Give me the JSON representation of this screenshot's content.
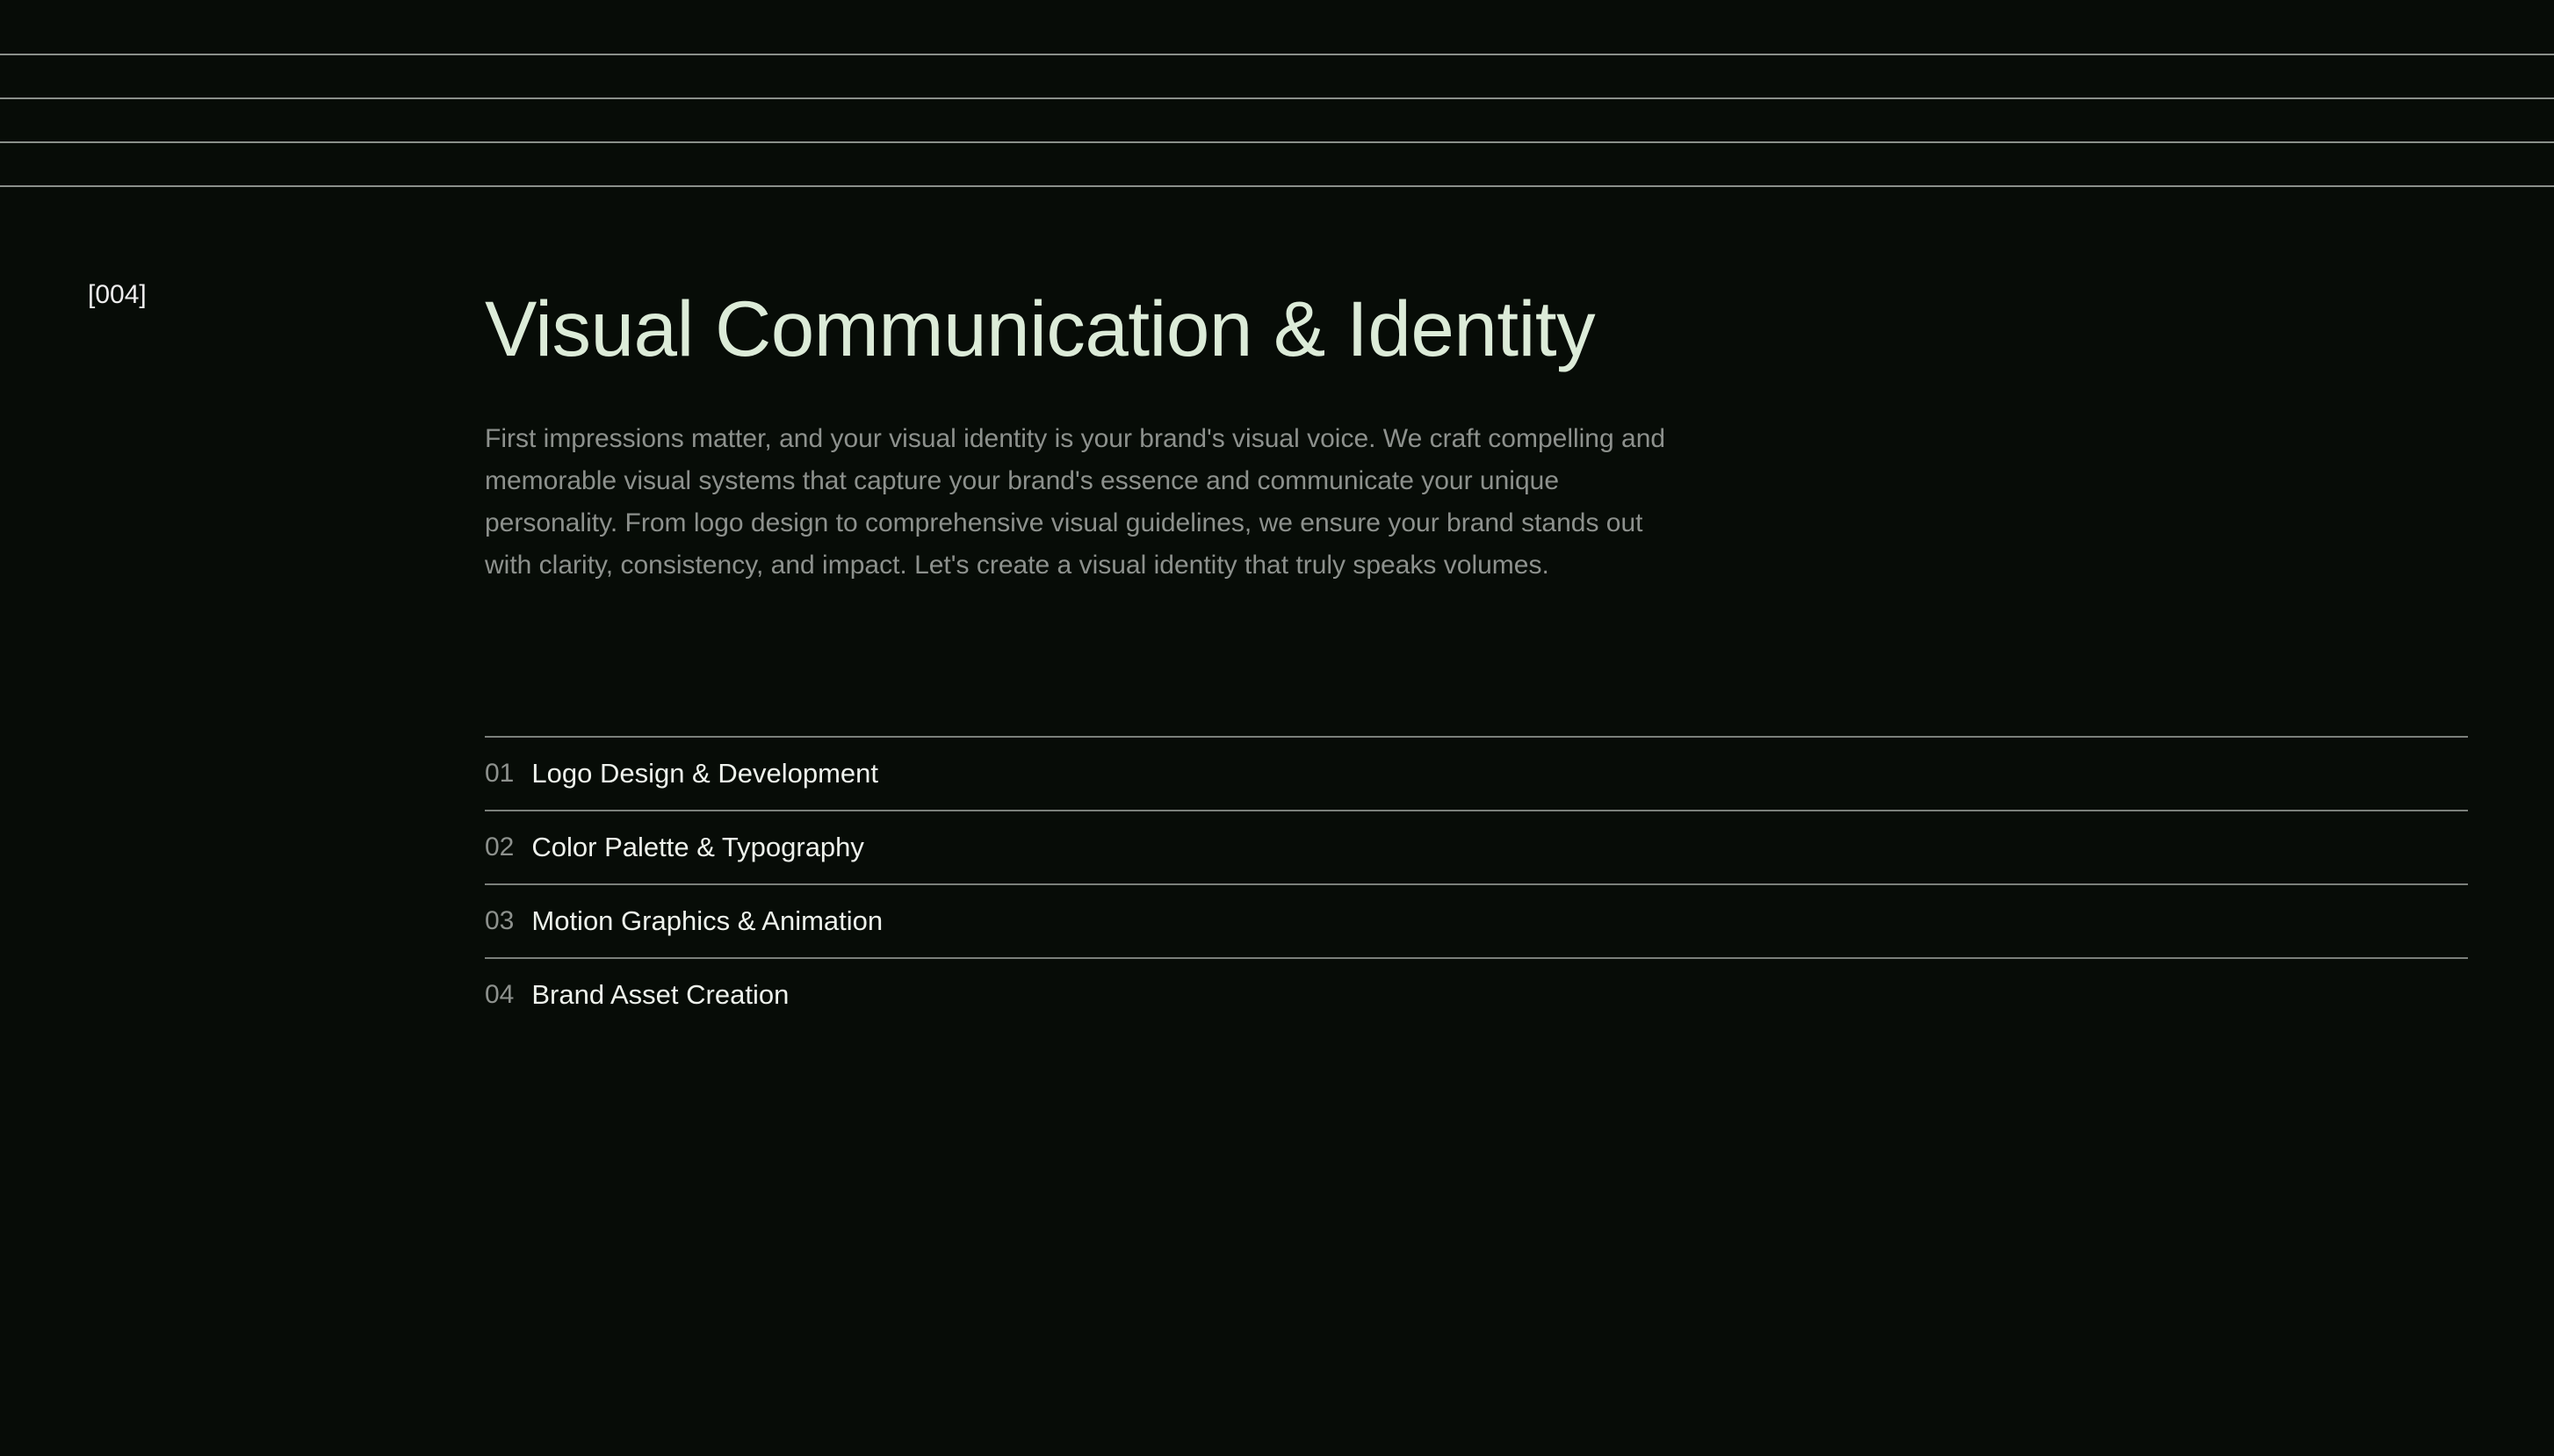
{
  "section": {
    "number": "[004]",
    "title": "Visual Communication & Identity",
    "description": "First impressions matter, and your visual identity is your brand's visual voice. We craft compelling and memorable visual systems that capture your brand's essence and communicate your unique personality. From logo design to comprehensive visual guidelines, we ensure your brand stands out with clarity, consistency, and impact. Let's create a visual identity that truly speaks volumes."
  },
  "services": [
    {
      "num": "01",
      "label": "Logo Design & Development"
    },
    {
      "num": "02",
      "label": "Color Palette & Typography"
    },
    {
      "num": "03",
      "label": "Motion Graphics & Animation"
    },
    {
      "num": "04",
      "label": "Brand Asset Creation"
    }
  ],
  "colors": {
    "background": "#070c07",
    "heading": "#dcebd8",
    "body_text": "#8d918d",
    "list_text": "#eef2ec",
    "divider": "#8a8f8a"
  }
}
